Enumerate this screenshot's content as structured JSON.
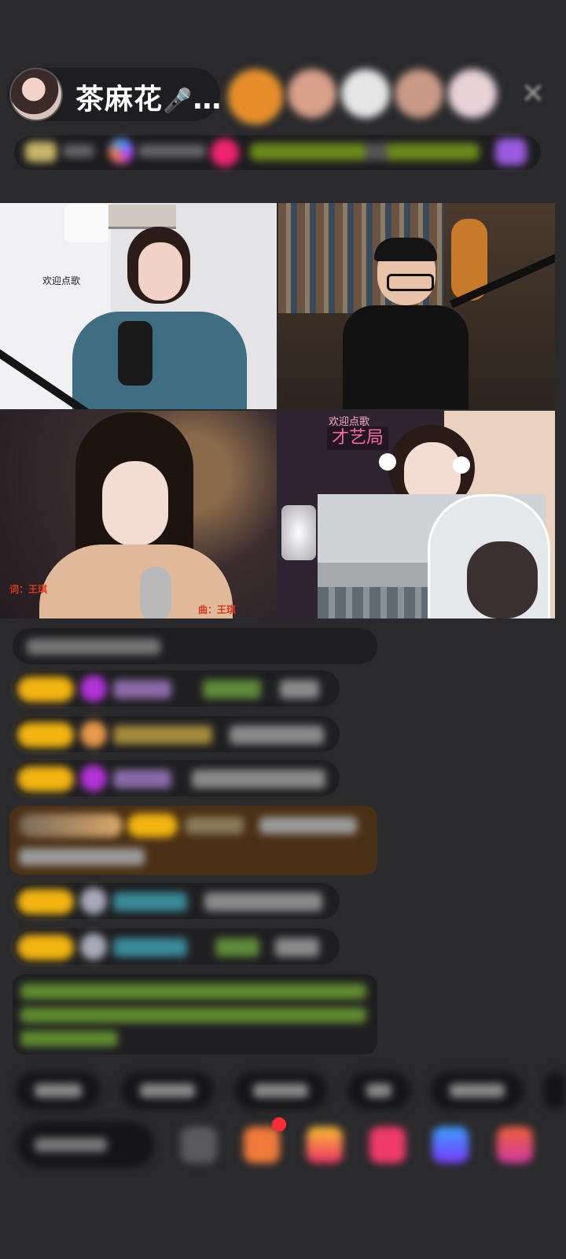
{
  "host": {
    "name": "茶麻花",
    "mic_glyph": "🎤",
    "ellipsis": "…"
  },
  "viewer_avatars": [
    "#e88c2a",
    "#d9a08a",
    "#e6e6e6",
    "#c99a86",
    "#e7d2d8"
  ],
  "rank_bar": {
    "accent": "#f02470"
  },
  "tiles": {
    "top_left": {
      "label": "欢迎点歌"
    },
    "bottom_left": {
      "lyric_label": "词：王琪",
      "music_label": "曲：王琪"
    },
    "bottom_right": {
      "label_small": "欢迎点歌",
      "label_big": "才艺局"
    }
  },
  "chat": {
    "accent_badge": "#f2b410",
    "highlight_bg": "#5a3a18",
    "green_text": "#7ea83a"
  }
}
